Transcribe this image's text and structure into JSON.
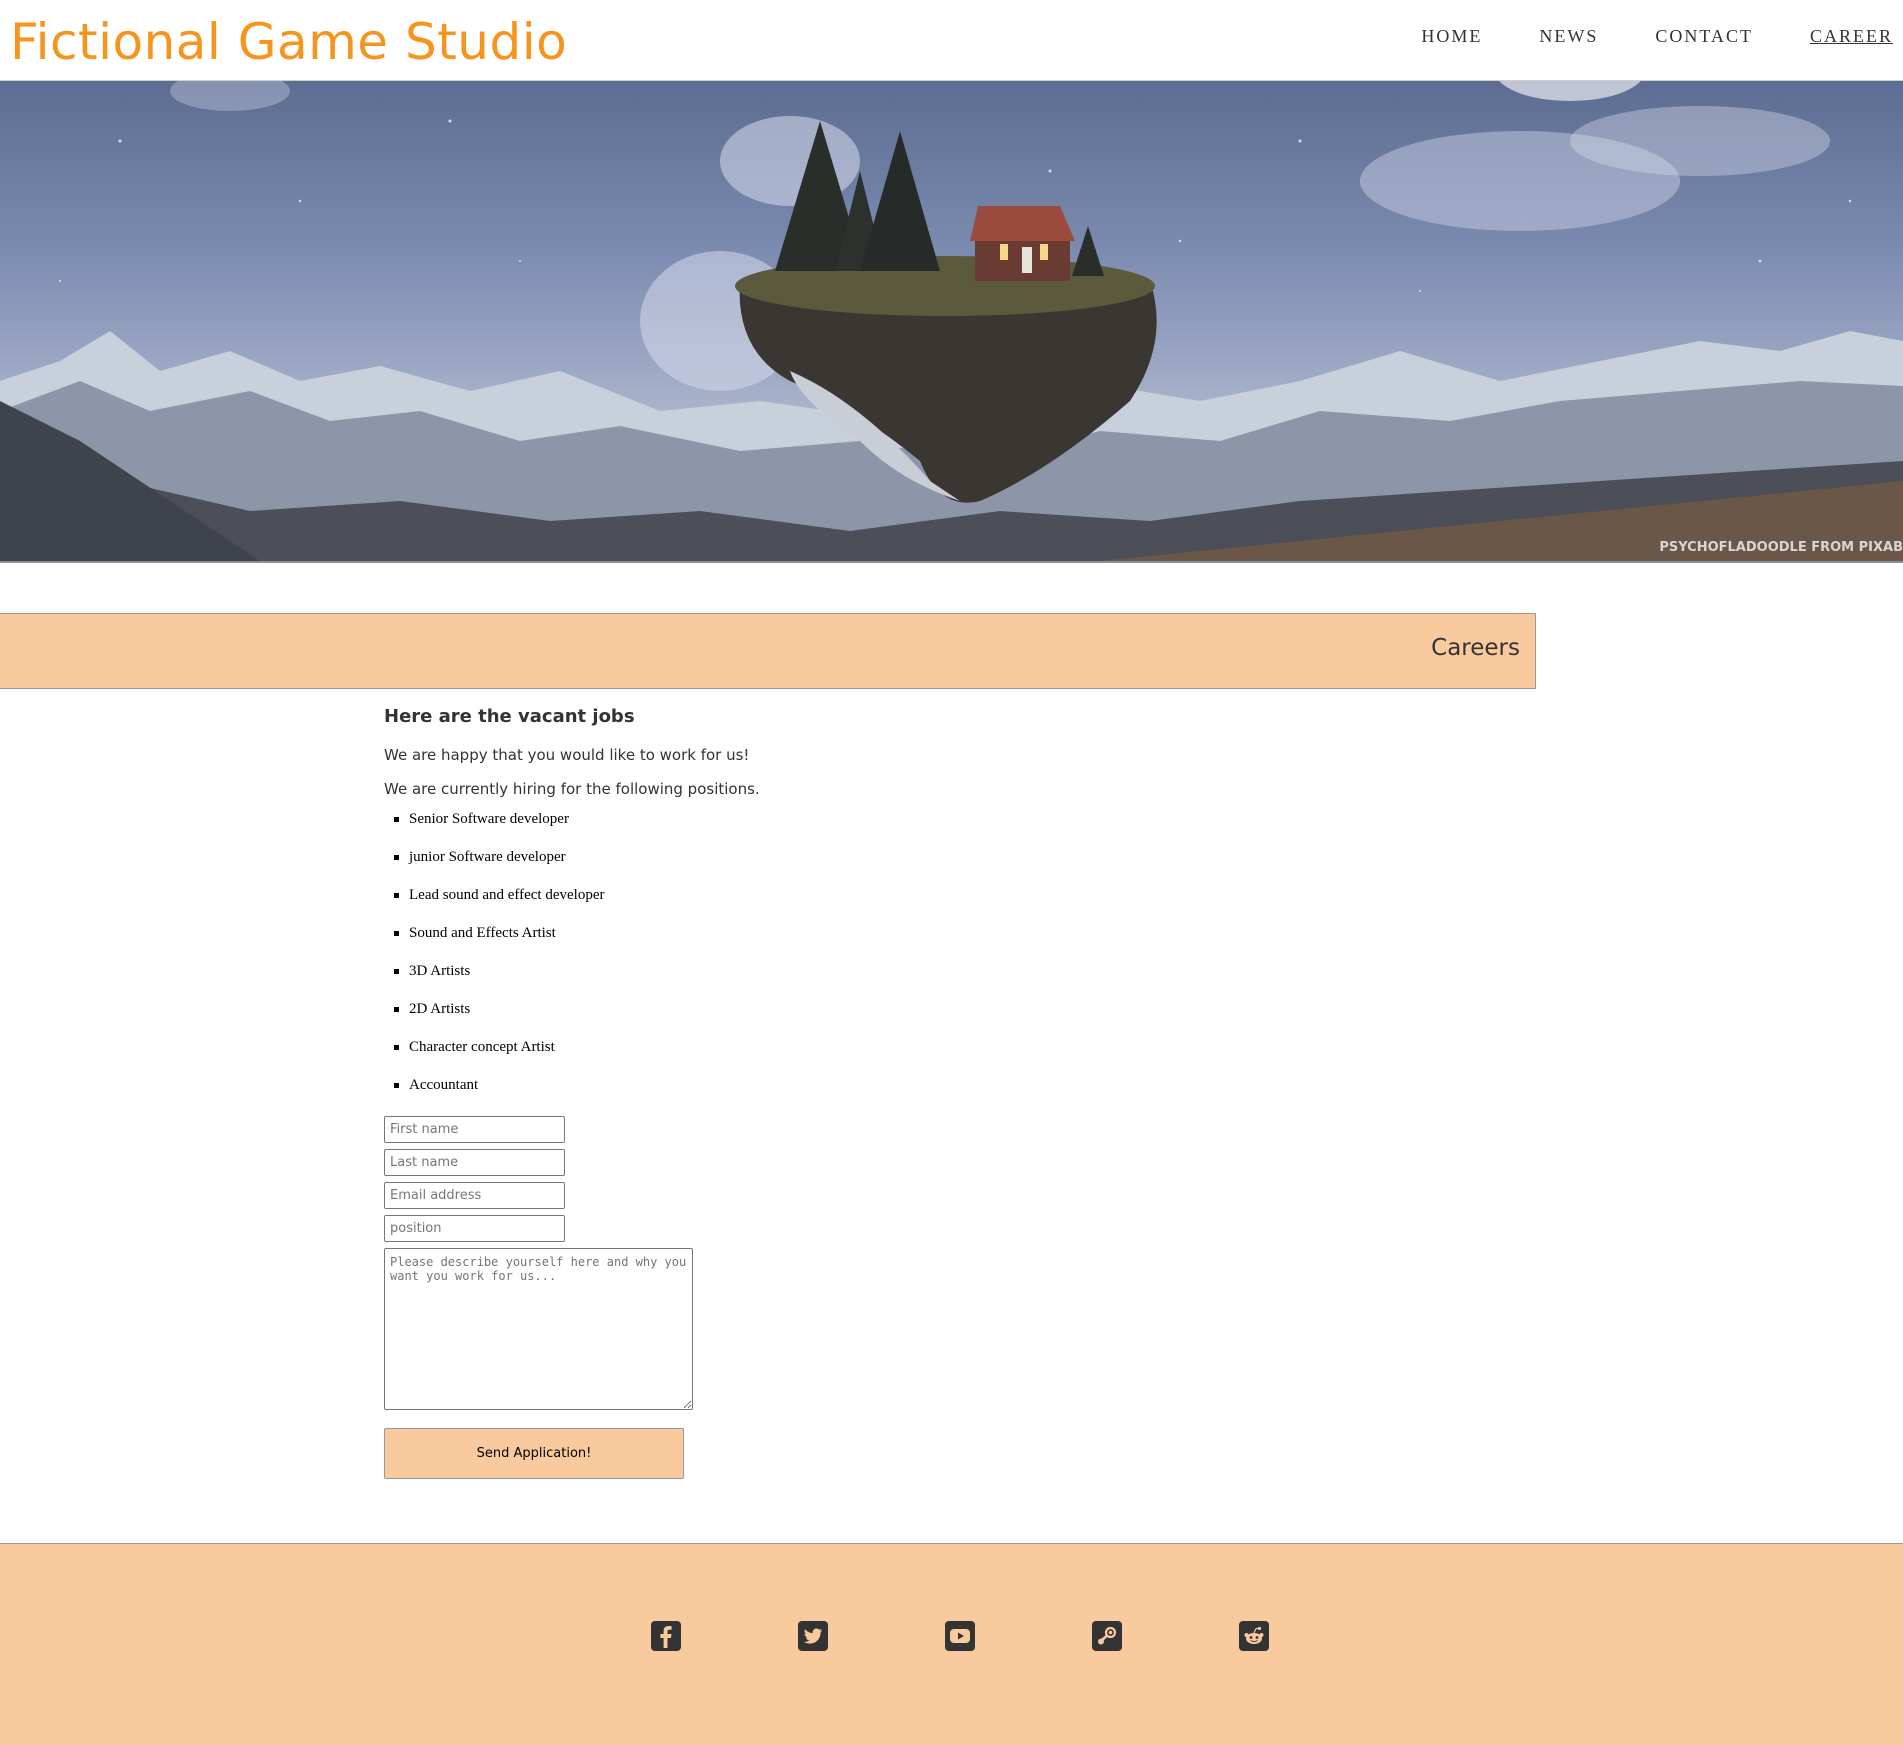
{
  "header": {
    "title": "Fictional Game Studio",
    "nav": [
      {
        "label": "HOME"
      },
      {
        "label": "NEWS"
      },
      {
        "label": "CONTACT"
      },
      {
        "label": "CAREER",
        "active": true
      }
    ]
  },
  "hero": {
    "credit": "PSYCHOFLADOODLE FROM PIXAB"
  },
  "careers": {
    "heading": "Careers",
    "subheading": "Here are the vacant jobs",
    "intro": "We are happy that you would like to work for us!",
    "hiring_text": "We are currently hiring for the following positions.",
    "jobs": [
      "Senior Software developer",
      "junior Software developer",
      "Lead sound and effect developer",
      "Sound and Effects Artist",
      "3D Artists",
      "2D Artists",
      "Character concept Artist",
      "Accountant"
    ]
  },
  "form": {
    "first_name_placeholder": "First name",
    "last_name_placeholder": "Last name",
    "email_placeholder": "Email address",
    "position_placeholder": "position",
    "message_placeholder": "Please describe yourself here and why you want you work for us...",
    "submit_label": "Send Application!"
  },
  "footer": {
    "icons": [
      "facebook-icon",
      "twitter-icon",
      "youtube-icon",
      "steam-icon",
      "reddit-icon"
    ]
  },
  "colors": {
    "brand": "#f7941d",
    "accent": "#f8ca9d",
    "text": "#333333"
  }
}
